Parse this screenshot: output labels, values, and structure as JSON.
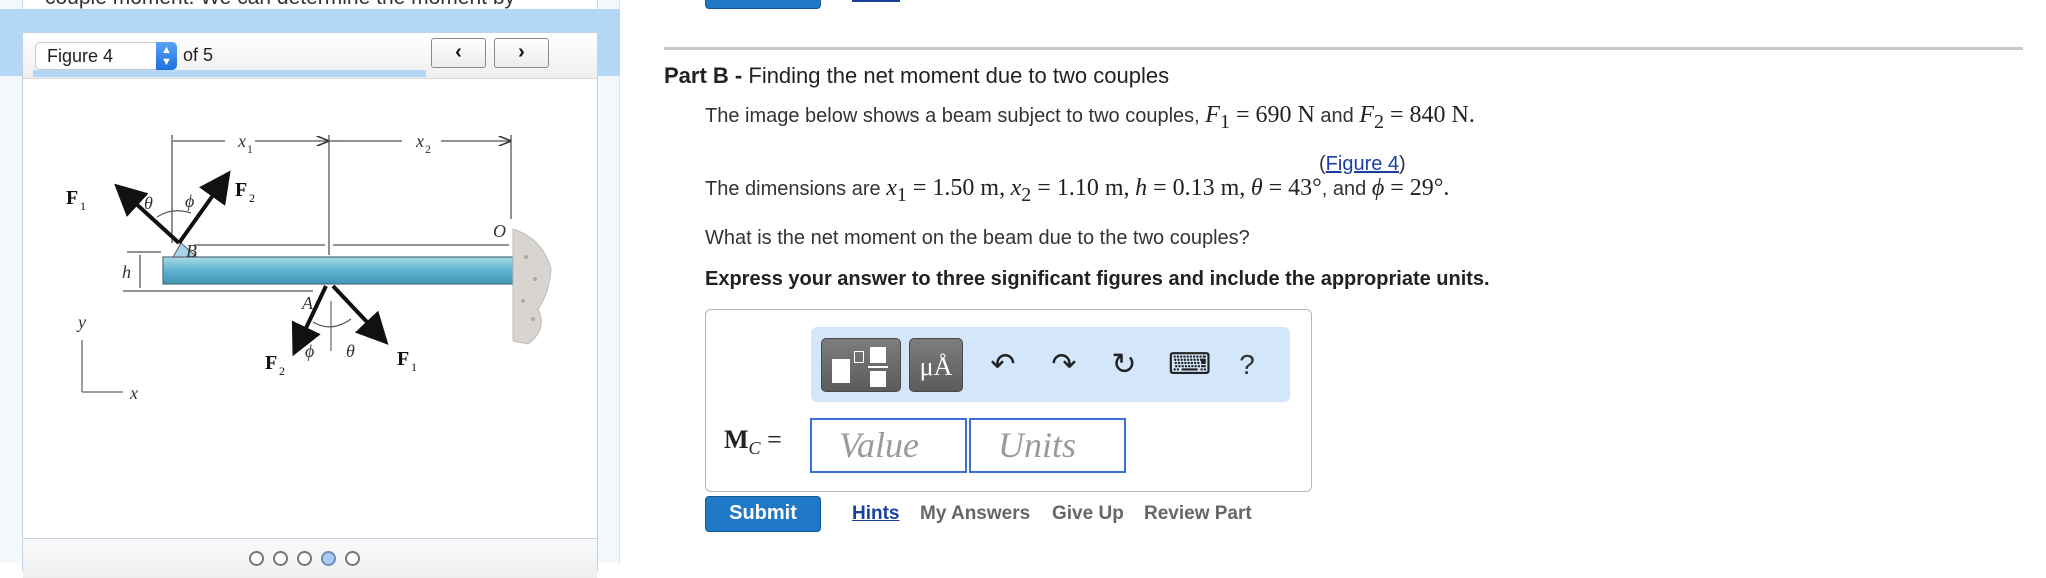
{
  "previous_section": {
    "cut_off_text": "couple moment. We can determine the moment by"
  },
  "figure_viewer": {
    "selected_figure": "Figure 4",
    "of_label": "of 5",
    "prev_label": "‹",
    "next_label": "›",
    "total_figures": 5,
    "current_index": 4,
    "figure_labels": {
      "F1": "F",
      "F1_sub": "1",
      "F2": "F",
      "F2_sub": "2",
      "theta": "θ",
      "phi": "ϕ",
      "x1": "x",
      "x1_sub": "1",
      "x2": "x",
      "x2_sub": "2",
      "h": "h",
      "B": "B",
      "A": "A",
      "O": "O",
      "y_axis": "y",
      "x_axis": "x"
    }
  },
  "part": {
    "label": "Part B -",
    "title": "Finding the net moment due to two couples",
    "intro_text": "The image below shows a beam subject to two couples,",
    "F1_name": "F",
    "F1_sub": "1",
    "F1_value": "= 690 N",
    "and1": "and",
    "F2_name": "F",
    "F2_sub": "2",
    "F2_value": "= 840 N.",
    "figure_link_open": "(",
    "figure_link": "Figure 4",
    "figure_link_close": ")",
    "dims_intro": "The dimensions are",
    "x1_name": "x",
    "x1_sub": "1",
    "x1_value": "= 1.50 m,",
    "x2_name": "x",
    "x2_sub": "2",
    "x2_value": "= 1.10 m,",
    "h_name": "h",
    "h_value": "= 0.13 m,",
    "theta_name": "θ",
    "theta_value": "= 43°",
    "and2": ", and",
    "phi_name": "ϕ",
    "phi_value": "= 29°.",
    "question": "What is the net moment on the beam due to the two couples?",
    "instruction": "Express your answer to three significant figures and include the appropriate units."
  },
  "answer": {
    "toolbar": {
      "templates_icon": "templates-icon",
      "units_label": "μÅ",
      "undo": "↶",
      "redo": "↷",
      "reset": "↻",
      "keyboard": "⌨",
      "help": "?"
    },
    "label_main": "M",
    "label_sub": "C",
    "label_eq": " =",
    "value_placeholder": "Value",
    "units_placeholder": "Units"
  },
  "actions": {
    "submit": "Submit",
    "hints": "Hints",
    "my_answers": "My Answers",
    "give_up": "Give Up",
    "review_part": "Review Part"
  },
  "colors": {
    "primary_button": "#1f78c8",
    "link": "#1a3fa0",
    "toolbar_bg": "#d3e6fa",
    "figure_band": "#b4d6f7",
    "beam": "#5fb3cf"
  }
}
